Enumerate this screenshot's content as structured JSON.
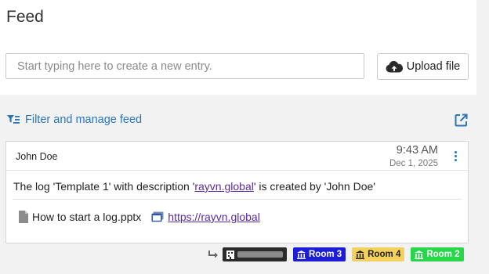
{
  "page": {
    "title": "Feed"
  },
  "composer": {
    "placeholder": "Start typing here to create a new entry.",
    "upload_label": "Upload file"
  },
  "filter": {
    "label": "Filter and manage feed"
  },
  "entry": {
    "author": "John Doe",
    "time": "9:43 AM",
    "date": "Dec 1, 2025",
    "message": {
      "before": "The log 'Template 1' with description '",
      "link": "rayvn.global",
      "after": "' is created by 'John Doe'"
    },
    "attachments": [
      {
        "name": "How to start a log.pptx",
        "icon": "file-icon"
      },
      {
        "name": "https://rayvn.global",
        "icon": "link-window-icon"
      }
    ]
  },
  "tags": [
    {
      "label": "",
      "icon": "building-icon",
      "color": "#2b2b2b"
    },
    {
      "label": "Room 3",
      "icon": "bank-icon",
      "color": "#1d1dd6"
    },
    {
      "label": "Room 4",
      "icon": "bank-icon",
      "color": "#f4d05c"
    },
    {
      "label": "Room 2",
      "icon": "bank-icon",
      "color": "#28d64a"
    }
  ],
  "colors": {
    "accent": "#2a74b8",
    "link": "#5a2b9a",
    "background": "#f2f2f2"
  }
}
